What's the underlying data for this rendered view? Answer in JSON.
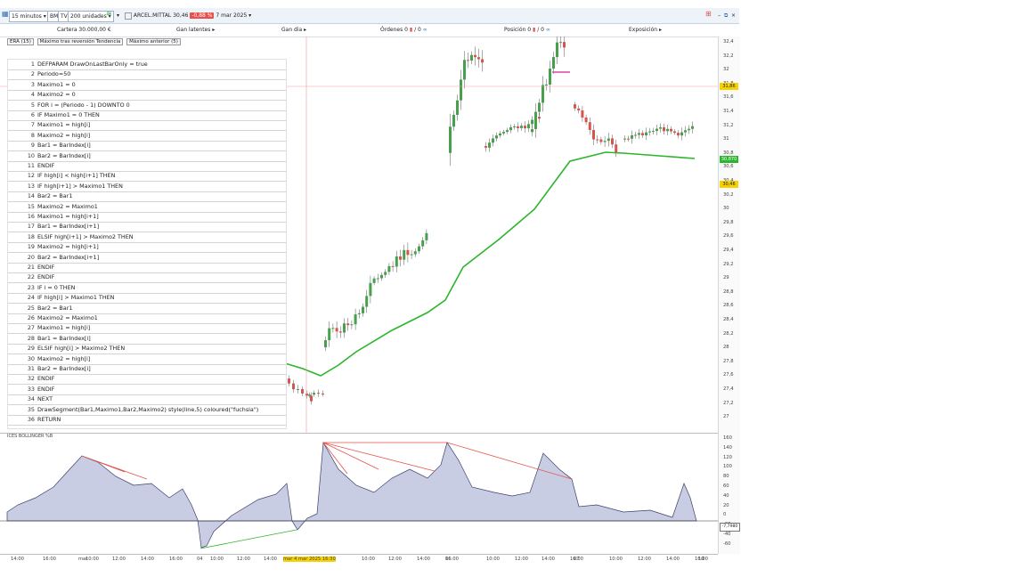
{
  "toolbar": {
    "timeframe": "15 minutos",
    "tab_bm": "BM",
    "tab_tv": "TV",
    "units": "200 unidades",
    "symbol": "ARCEL.MITTAL",
    "last_price": "30,46",
    "change_pct": "-0,88 %",
    "date": "7 mar 2025"
  },
  "account": {
    "cartera": "Cartera 30.000,00 €",
    "gan_latentes": "Gan latentes",
    "gan_dia": "Gan dia",
    "ordenes": "Órdenes 0",
    "ordenes_b": "0",
    "posicion": "Posición 0",
    "posicion_b": "0",
    "exposicion": "Exposición"
  },
  "indicators": [
    "ERA (15)",
    "Máximo tras reversión Tendencia",
    "Máximo anterior (5)"
  ],
  "code_lines": [
    {
      "n": "1",
      "t": "DEFPARAM DrawOnLastBarOnly = true"
    },
    {
      "n": "2",
      "t": "Periodo=50"
    },
    {
      "n": "3",
      "t": "Maximo1 = 0"
    },
    {
      "n": "4",
      "t": "Maximo2 = 0"
    },
    {
      "n": "5",
      "t": "FOR i = (Periodo - 1) DOWNTO 0"
    },
    {
      "n": "6",
      "t": "IF Maximo1 = 0 THEN"
    },
    {
      "n": "7",
      "t": "Maximo1 = high[i]"
    },
    {
      "n": "8",
      "t": "Maximo2 = high[i]"
    },
    {
      "n": "9",
      "t": "Bar1 = BarIndex[i]"
    },
    {
      "n": "10",
      "t": "Bar2 = BarIndex[i]"
    },
    {
      "n": "11",
      "t": "ENDIF"
    },
    {
      "n": "12",
      "t": "IF high[i] < high[i+1] THEN"
    },
    {
      "n": "13",
      "t": "IF high[i+1] > Maximo1 THEN"
    },
    {
      "n": "14",
      "t": "Bar2 = Bar1"
    },
    {
      "n": "15",
      "t": "Maximo2 = Maximo1"
    },
    {
      "n": "16",
      "t": "Maximo1 = high[i+1]"
    },
    {
      "n": "17",
      "t": "Bar1 = BarIndex[i+1]"
    },
    {
      "n": "18",
      "t": "ELSIF high[i+1] > Maximo2 THEN"
    },
    {
      "n": "19",
      "t": "Maximo2 = high[i+1]"
    },
    {
      "n": "20",
      "t": "Bar2 = BarIndex[i+1]"
    },
    {
      "n": "21",
      "t": "ENDIF"
    },
    {
      "n": "22",
      "t": "ENDIF"
    },
    {
      "n": "23",
      "t": "IF i = 0 THEN"
    },
    {
      "n": "24",
      "t": "IF high[i] > Maximo1 THEN"
    },
    {
      "n": "25",
      "t": "Bar2 = Bar1"
    },
    {
      "n": "26",
      "t": "Maximo2 = Maximo1"
    },
    {
      "n": "27",
      "t": "Maximo1 = high[i]"
    },
    {
      "n": "28",
      "t": "Bar1 = BarIndex[i]"
    },
    {
      "n": "29",
      "t": "ELSIF high[i] > Maximo2 THEN"
    },
    {
      "n": "30",
      "t": "Maximo2 = high[i]"
    },
    {
      "n": "31",
      "t": "Bar2 = BarIndex[i]"
    },
    {
      "n": "32",
      "t": "ENDIF"
    },
    {
      "n": "33",
      "t": "ENDIF"
    },
    {
      "n": "34",
      "t": "NEXT"
    },
    {
      "n": "35",
      "t": "DrawSegment(Bar1,Maximo1,Bar2,Maximo2) style(line,5) coloured(\"fuchsia\")"
    },
    {
      "n": "36",
      "t": "RETURN"
    }
  ],
  "price_axis": [
    "32,4",
    "32,2",
    "32",
    "31,8",
    "31,6",
    "31,4",
    "31,2",
    "31",
    "30,8",
    "30,6",
    "30,4",
    "30,2",
    "30",
    "29,8",
    "29,6",
    "29,4",
    "29,2",
    "29",
    "28,8",
    "28,6",
    "28,4",
    "28,2",
    "28",
    "27,8",
    "27,6",
    "27,4",
    "27,2",
    "27"
  ],
  "price_labels": {
    "level": "31,86",
    "ema": "30,870",
    "last": "30,46"
  },
  "osc_axis": [
    "160",
    "140",
    "120",
    "100",
    "80",
    "60",
    "40",
    "20",
    "0",
    "-20",
    "-40",
    "-60"
  ],
  "osc_label": "-7,7980",
  "osc_title": "ICES BOLLINGER %B",
  "x_axis": [
    "14:00",
    "16:00",
    "mar",
    "10:00",
    "12:00",
    "14:00",
    "16:00",
    "04",
    "10:00",
    "12:00",
    "14:00",
    "mar 4 mar 2025 16:30",
    "10:00",
    "12:00",
    "14:00",
    "16:00",
    "06",
    "10:00",
    "12:00",
    "14:00",
    "16:00",
    "07",
    "10:00",
    "12:00",
    "14:00",
    "16:00",
    "10"
  ],
  "colors": {
    "up": "#46a04c",
    "down": "#d9534f",
    "ema": "#2bb52b",
    "line": "#e5534b",
    "osc_fill": "#9aa4cc"
  }
}
